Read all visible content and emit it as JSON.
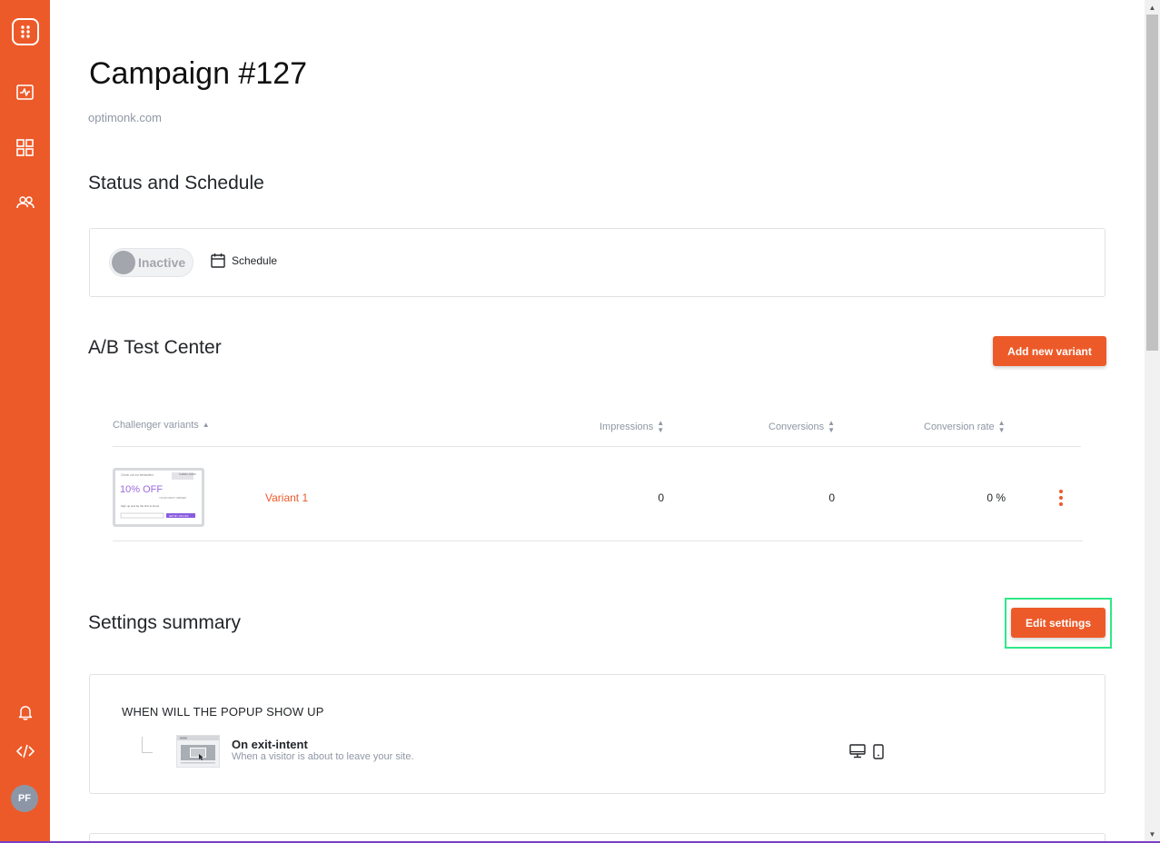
{
  "sidebar": {
    "items": [
      {
        "icon": "logo-icon"
      },
      {
        "icon": "analytics-icon"
      },
      {
        "icon": "dashboard-grid-icon"
      },
      {
        "icon": "users-icon"
      }
    ],
    "bottom_items": [
      {
        "icon": "bell-icon"
      },
      {
        "icon": "code-icon"
      }
    ],
    "avatar_initials": "PF",
    "color": "#ed5a29"
  },
  "page": {
    "title": "Campaign #127",
    "domain": "optimonk.com"
  },
  "status": {
    "section_title": "Status and Schedule",
    "toggle_label": "Inactive",
    "schedule_label": "Schedule"
  },
  "ab_test": {
    "section_title": "A/B Test Center",
    "add_button": "Add new variant",
    "columns": {
      "variant": "Challenger variants",
      "impressions": "Impressions",
      "conversions": "Conversions",
      "rate": "Conversion rate"
    },
    "rows": [
      {
        "name": "Variant 1",
        "impressions": "0",
        "conversions": "0",
        "rate": "0 %",
        "thumb": {
          "headline": "10% OFF",
          "small_top": "Check out our bestsellers",
          "small_sub": "YOUR FIRST ORDER",
          "small_line": "Sign up and be the first to know",
          "cta": "GET MY 10% OFF",
          "badge": "THANK LOOKS"
        }
      }
    ]
  },
  "settings": {
    "section_title": "Settings summary",
    "edit_button": "Edit settings",
    "when_title": "WHEN WILL THE POPUP SHOW UP",
    "trigger_title": "On exit-intent",
    "trigger_desc": "When a visitor is about to leave your site."
  },
  "colors": {
    "accent": "#ed5a29",
    "highlight": "#2ee887"
  }
}
